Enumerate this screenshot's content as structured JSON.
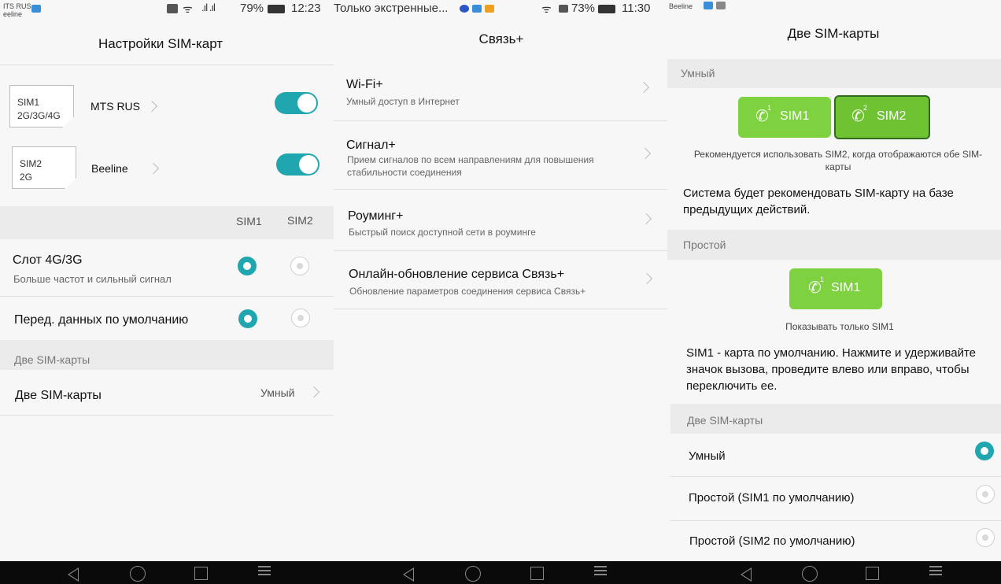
{
  "screen1": {
    "status": {
      "carrier1": "ITS RUS",
      "carrier2": "eeline",
      "signal": "79%",
      "time": "12:23"
    },
    "title": "Настройки SIM-карт",
    "sim1": {
      "card": "SIM1",
      "card_types": "2G/3G/4G",
      "operator": "MTS RUS"
    },
    "sim2": {
      "card": "SIM2",
      "card_types": "2G",
      "operator": "Beeline"
    },
    "col_sim1": "SIM1",
    "col_sim2": "SIM2",
    "slot": {
      "title": "Слот 4G/3G",
      "subtitle": "Больше частот и сильный сигнал"
    },
    "data_default": {
      "title": "Перед. данных по умолчанию"
    },
    "section_dual": "Две SIM-карты",
    "dual_row": {
      "title": "Две SIM-карты",
      "value": "Умный"
    }
  },
  "screen2": {
    "status": {
      "notification": "Только экстренные...",
      "battery": "73%",
      "time": "11:30"
    },
    "title": "Связь+",
    "items": [
      {
        "title": "Wi-Fi+",
        "subtitle": "Умный доступ в Интернет"
      },
      {
        "title": "Сигнал+",
        "subtitle": "Прием сигналов по всем направлениям для повышения стабильности соединения"
      },
      {
        "title": "Роуминг+",
        "subtitle": "Быстрый поиск доступной сети в роуминге"
      },
      {
        "title": "Онлайн-обновление сервиса Связь+",
        "subtitle": "Обновление параметров соединения сервиса Связь+"
      }
    ]
  },
  "screen3": {
    "status": {
      "carrier": "Beeline"
    },
    "title": "Две SIM-карты",
    "smart_head": "Умный",
    "btn_sim1": "SIM1",
    "btn_sim2": "SIM2",
    "btn_sim1_num": "1",
    "btn_sim2_num": "2",
    "smart_note": "Рекомендуется использовать SIM2, когда отображаются обе SIM-карты",
    "smart_desc": "Система будет рекомендовать SIM-карту на базе предыдущих действий.",
    "simple_head": "Простой",
    "simple_btn": "SIM1",
    "simple_note": "Показывать только SIM1",
    "simple_desc": "SIM1 - карта по умолчанию. Нажмите и удерживайте значок вызова, проведите влево или вправо, чтобы переключить ее.",
    "dual_head": "Две SIM-карты",
    "options": [
      {
        "label": "Умный",
        "selected": true
      },
      {
        "label": "Простой (SIM1 по умолчанию)",
        "selected": false
      },
      {
        "label": "Простой (SIM2 по умолчанию)",
        "selected": false
      }
    ]
  },
  "colors": {
    "accent": "#1fa6ae",
    "sim_green": "#7ed240",
    "navbar": "#0a0a0a"
  },
  "icons": [
    "nfc-icon",
    "wifi-icon",
    "signal-icon",
    "battery-icon",
    "chevron-right-icon",
    "phone-icon",
    "back-icon",
    "home-icon",
    "recent-apps-icon",
    "menu-icon"
  ]
}
